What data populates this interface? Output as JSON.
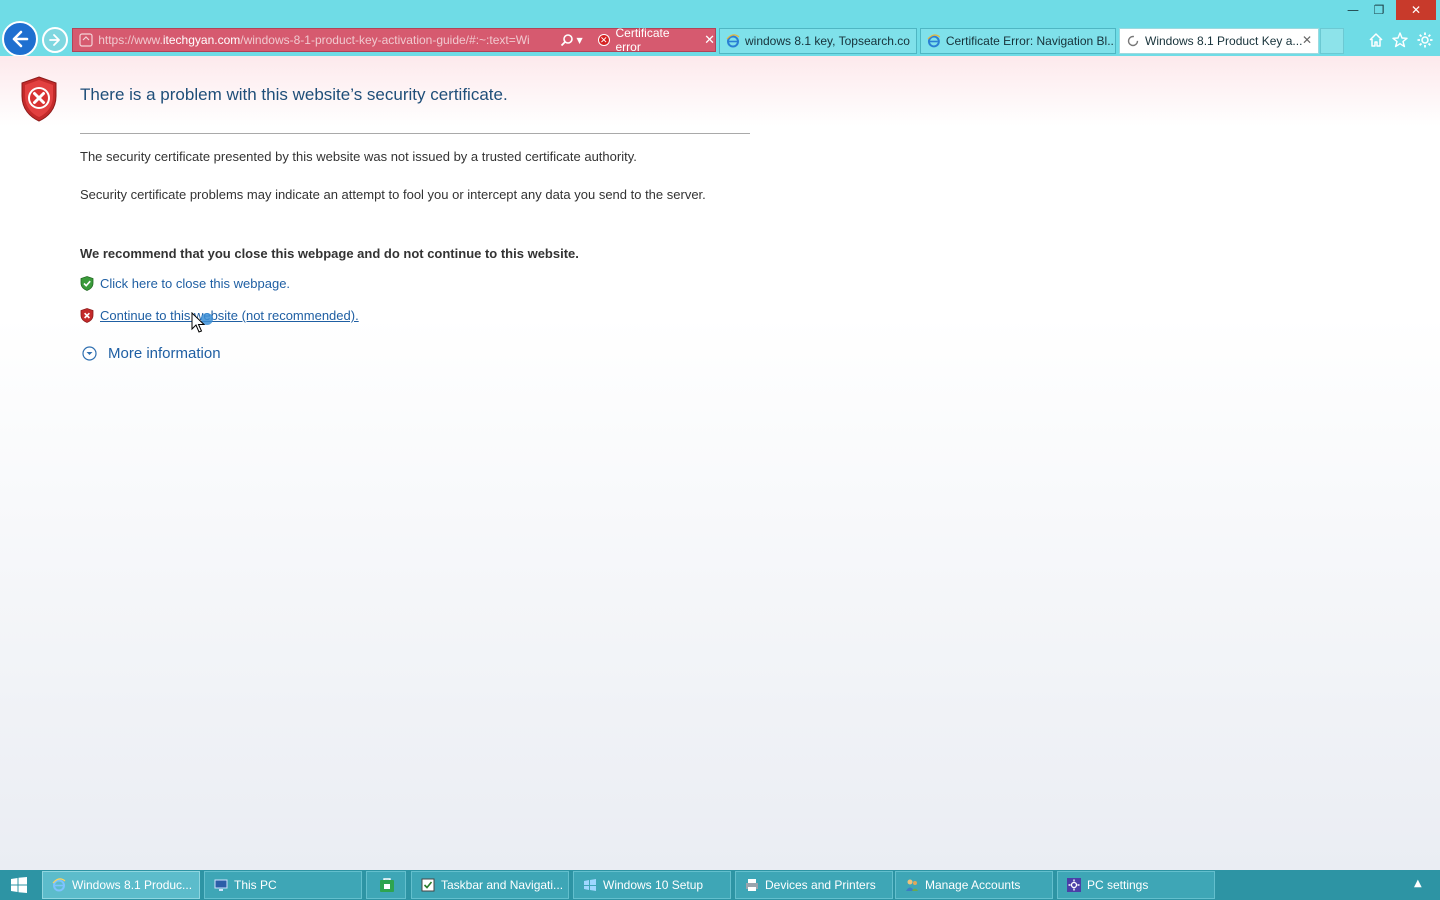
{
  "window": {
    "minimize": "—",
    "maximize": "❐",
    "close": "✕"
  },
  "address_bar": {
    "url_prefix": "https://www.",
    "url_host": "itechgyan.com",
    "url_rest": "/windows-8-1-product-key-activation-guide/#:~:text=Wi",
    "cert_label": "Certificate error",
    "cert_close": "✕"
  },
  "tabs": [
    {
      "title": "windows 8.1 key, Topsearch.co",
      "active": false
    },
    {
      "title": "Certificate Error: Navigation Bl...",
      "active": false
    },
    {
      "title": "Windows 8.1 Product Key a...",
      "active": true,
      "close": "✕"
    }
  ],
  "page": {
    "title": "There is a problem with this website’s security certificate.",
    "p1": "The security certificate presented by this website was not issued by a trusted certificate authority.",
    "p2": "Security certificate problems may indicate an attempt to fool you or intercept any data you send to the server.",
    "recommend": "We recommend that you close this webpage and do not continue to this website.",
    "close_link": "Click here to close this webpage.",
    "continue_link": "Continue to this website (not recommended).",
    "more_info": "More information"
  },
  "taskbar": {
    "items": [
      {
        "label": "Windows 8.1 Produc...",
        "icon": "ie-icon",
        "active": true
      },
      {
        "label": "This PC",
        "icon": "this-pc-icon"
      },
      {
        "label": "",
        "icon": "store-icon"
      },
      {
        "label": "Taskbar and Navigati...",
        "icon": "taskbar-properties-icon"
      },
      {
        "label": "Windows 10 Setup",
        "icon": "setup-icon"
      },
      {
        "label": "Devices and Printers",
        "icon": "printer-icon"
      },
      {
        "label": "Manage Accounts",
        "icon": "accounts-icon"
      },
      {
        "label": "PC settings",
        "icon": "gear-icon"
      }
    ],
    "tray_chevron": "▲"
  },
  "colors": {
    "toolbar": "#6fdce6",
    "address_error": "#d65a6f",
    "link": "#1f5fa3",
    "title": "#1f4e79",
    "taskbar": "#2d94a4"
  }
}
